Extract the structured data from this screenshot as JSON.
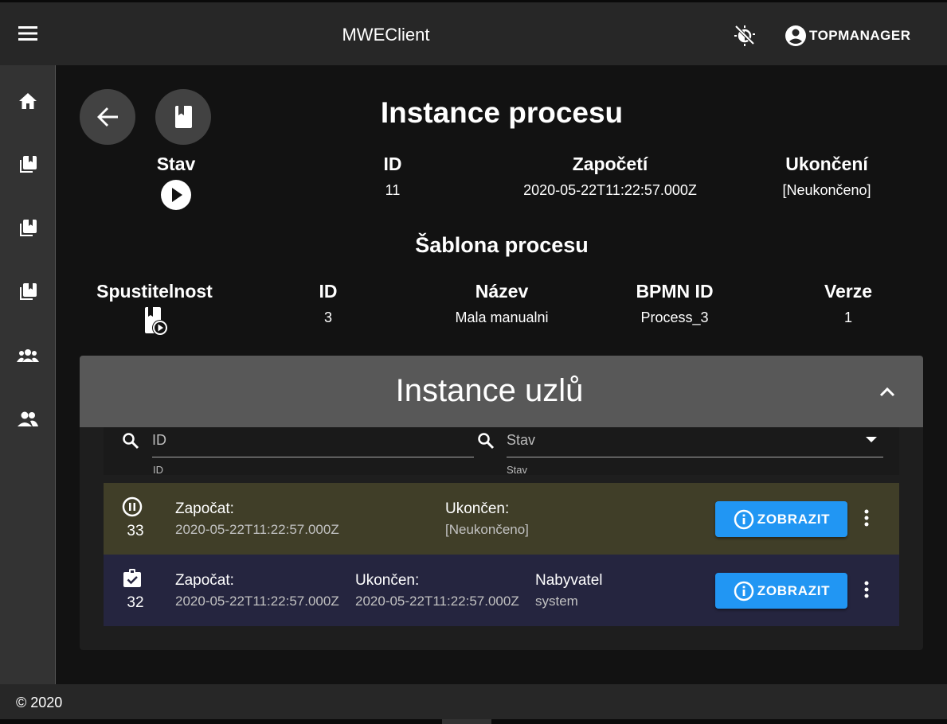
{
  "appbar": {
    "title": "MWEClient",
    "user": "TOPMANAGER"
  },
  "sidebar": {
    "items": [
      "home-icon",
      "library-icon",
      "library-icon",
      "library-icon",
      "group-icon",
      "people-icon"
    ]
  },
  "page": {
    "title": "Instance procesu",
    "instance": {
      "stav_label": "Stav",
      "id_label": "ID",
      "id_value": "11",
      "start_label": "Započetí",
      "start_value": "2020-05-22T11:22:57.000Z",
      "end_label": "Ukončení",
      "end_value": "[Neukončeno]"
    },
    "template_title": "Šablona procesu",
    "template": {
      "runnable_label": "Spustitelnost",
      "id_label": "ID",
      "id_value": "3",
      "name_label": "Název",
      "name_value": "Mala manualni",
      "bpmn_label": "BPMN ID",
      "bpmn_value": "Process_3",
      "version_label": "Verze",
      "version_value": "1"
    }
  },
  "nodes": {
    "title": "Instance uzlů",
    "filter_id": {
      "placeholder": "ID",
      "hint": "ID"
    },
    "filter_state": {
      "placeholder": "Stav",
      "hint": "Stav"
    },
    "rows": [
      {
        "status_icon": "pause-circle-icon",
        "id": "33",
        "bg": "#403e28",
        "start_label": "Započat:",
        "start_value": "2020-05-22T11:22:57.000Z",
        "end_label": "Ukončen:",
        "end_value": "[Neukončeno]",
        "button": "ZOBRAZIT"
      },
      {
        "status_icon": "assignment-done-icon",
        "id": "32",
        "bg": "#25253f",
        "start_label": "Započat:",
        "start_value": "2020-05-22T11:22:57.000Z",
        "end_label": "Ukončen:",
        "end_value": "2020-05-22T11:22:57.000Z",
        "assignee_label": "Nabyvatel",
        "assignee_value": "system",
        "button": "ZOBRAZIT"
      }
    ]
  },
  "footer": {
    "text": "© 2020"
  },
  "colors": {
    "accent": "#2196f3",
    "appbar": "#272727",
    "sidebar": "#333333",
    "panel_header": "#585858"
  }
}
